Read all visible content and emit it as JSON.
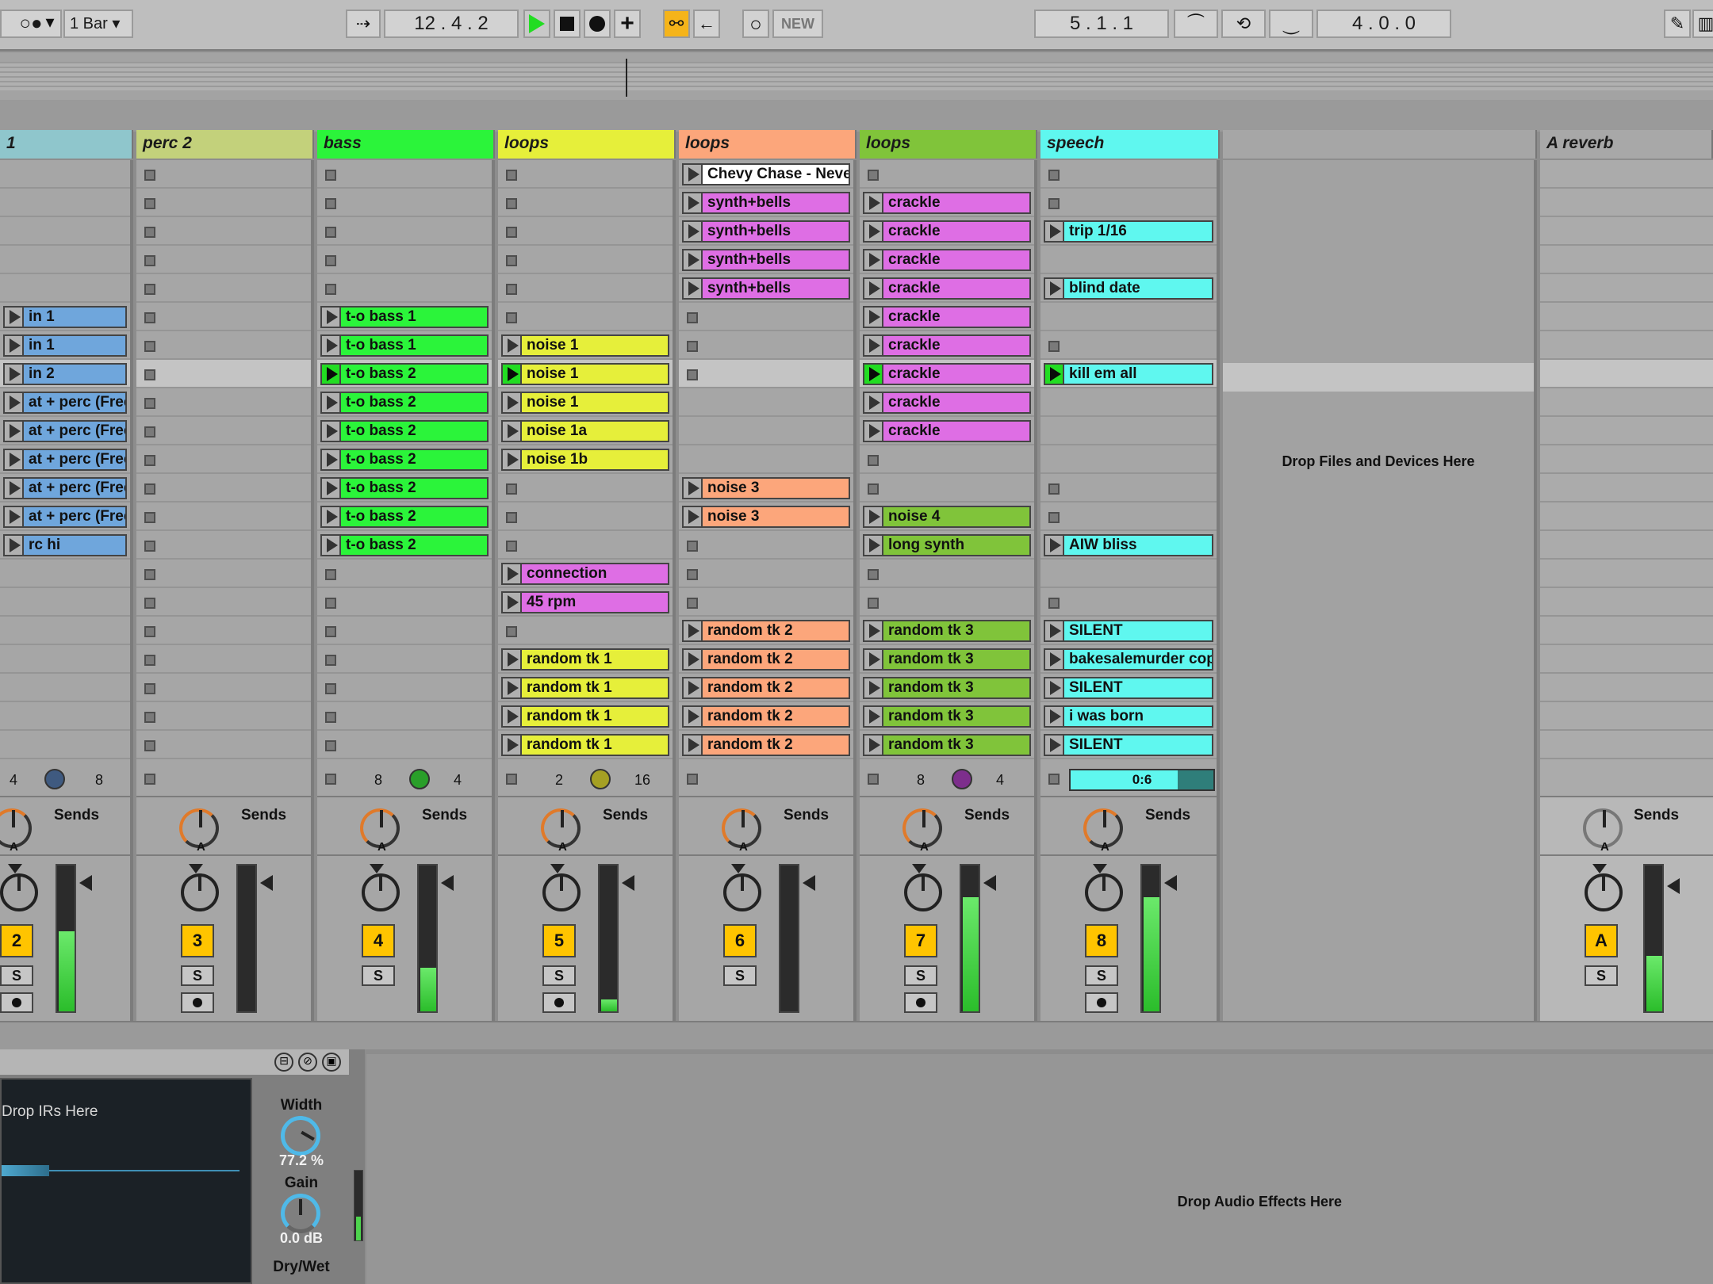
{
  "transport": {
    "quantize": "1 Bar",
    "arrangement_position": "12 .  4 .  2",
    "new_label": "NEW",
    "loop_start": "5 .  1 .  1",
    "loop_length": "4 .  0 .  0"
  },
  "tracks": [
    {
      "name": "1",
      "color": "#8fc6cc",
      "number": "2",
      "ctrl": [
        "4",
        "8"
      ],
      "knob_color": "#3f5a80",
      "meter": 0.55,
      "clips": [
        null,
        null,
        null,
        null,
        null,
        {
          "t": "in 1",
          "c": "#6fa6dc"
        },
        {
          "t": "in 1",
          "c": "#6fa6dc"
        },
        {
          "t": "in 2",
          "c": "#6fa6dc"
        },
        {
          "t": "at + perc (Freeze)",
          "c": "#6fa6dc"
        },
        {
          "t": "at + perc (Freeze)",
          "c": "#6fa6dc"
        },
        {
          "t": "at + perc (Freeze)",
          "c": "#6fa6dc"
        },
        {
          "t": "at + perc (Freeze)",
          "c": "#6fa6dc"
        },
        {
          "t": "at + perc (Freeze)",
          "c": "#6fa6dc"
        },
        {
          "t": "rc hi",
          "c": "#6fa6dc"
        },
        null,
        null,
        null,
        null,
        null,
        null,
        null
      ]
    },
    {
      "name": "perc 2",
      "color": "#c3d17b",
      "number": "3",
      "ctrl": null,
      "meter": 0.0,
      "clips": [
        "s",
        "s",
        "s",
        "s",
        "s",
        "s",
        "s",
        "s",
        "s",
        "s",
        "s",
        "s",
        "s",
        "s",
        "s",
        "s",
        "s",
        "s",
        "s",
        "s",
        "s"
      ]
    },
    {
      "name": "bass",
      "color": "#2bf43a",
      "number": "4",
      "ctrl": [
        "8",
        "4"
      ],
      "knob_color": "#2a9f2a",
      "meter": 0.3,
      "clips": [
        "s",
        "s",
        "s",
        "s",
        "s",
        {
          "t": "t-o bass 1",
          "c": "#2bf43a"
        },
        {
          "t": "t-o bass 1",
          "c": "#2bf43a"
        },
        {
          "t": "t-o bass 2",
          "c": "#2bf43a",
          "p": true
        },
        {
          "t": "t-o bass 2",
          "c": "#2bf43a"
        },
        {
          "t": "t-o bass 2",
          "c": "#2bf43a"
        },
        {
          "t": "t-o bass 2",
          "c": "#2bf43a"
        },
        {
          "t": "t-o bass 2",
          "c": "#2bf43a"
        },
        {
          "t": "t-o bass 2",
          "c": "#2bf43a"
        },
        {
          "t": "t-o bass 2",
          "c": "#2bf43a"
        },
        "s",
        "s",
        "s",
        "s",
        "s",
        "s",
        "s"
      ]
    },
    {
      "name": "loops",
      "color": "#e6ef3a",
      "number": "5",
      "ctrl": [
        "2",
        "16"
      ],
      "knob_color": "#a5a023",
      "meter": 0.08,
      "clips": [
        "s",
        "s",
        "s",
        "s",
        "s",
        "s",
        {
          "t": "noise 1",
          "c": "#e6ef3a"
        },
        {
          "t": "noise 1",
          "c": "#e6ef3a",
          "p": true
        },
        {
          "t": "noise 1",
          "c": "#e6ef3a"
        },
        {
          "t": "noise 1a",
          "c": "#e6ef3a"
        },
        {
          "t": "noise 1b",
          "c": "#e6ef3a"
        },
        "s",
        "s",
        "s",
        {
          "t": "connection",
          "c": "#de6ee4"
        },
        {
          "t": "45 rpm",
          "c": "#de6ee4"
        },
        "s",
        {
          "t": "random tk 1",
          "c": "#e6ef3a"
        },
        {
          "t": "random tk 1",
          "c": "#e6ef3a"
        },
        {
          "t": "random tk 1",
          "c": "#e6ef3a"
        },
        {
          "t": "random tk 1",
          "c": "#e6ef3a"
        }
      ]
    },
    {
      "name": "loops",
      "color": "#fca67b",
      "number": "6",
      "ctrl": null,
      "meter": 0.0,
      "clips": [
        {
          "t": "Chevy Chase - Neve",
          "c": "#ffffff"
        },
        {
          "t": "synth+bells",
          "c": "#de6ee4"
        },
        {
          "t": "synth+bells",
          "c": "#de6ee4"
        },
        {
          "t": "synth+bells",
          "c": "#de6ee4"
        },
        {
          "t": "synth+bells",
          "c": "#de6ee4"
        },
        "s",
        "s",
        "s",
        null,
        null,
        null,
        {
          "t": "noise 3",
          "c": "#fca67b"
        },
        {
          "t": "noise 3",
          "c": "#fca67b"
        },
        "s",
        "s",
        "s",
        {
          "t": "random tk 2",
          "c": "#fca67b"
        },
        {
          "t": "random tk 2",
          "c": "#fca67b"
        },
        {
          "t": "random tk 2",
          "c": "#fca67b"
        },
        {
          "t": "random tk 2",
          "c": "#fca67b"
        },
        {
          "t": "random tk 2",
          "c": "#fca67b"
        }
      ]
    },
    {
      "name": "loops",
      "color": "#80c43a",
      "number": "7",
      "ctrl": [
        "8",
        "4"
      ],
      "knob_color": "#7d2e8c",
      "meter": 0.78,
      "clips": [
        "s",
        {
          "t": "crackle",
          "c": "#de6ee4"
        },
        {
          "t": "crackle",
          "c": "#de6ee4"
        },
        {
          "t": "crackle",
          "c": "#de6ee4"
        },
        {
          "t": "crackle",
          "c": "#de6ee4"
        },
        {
          "t": "crackle",
          "c": "#de6ee4"
        },
        {
          "t": "crackle",
          "c": "#de6ee4"
        },
        {
          "t": "crackle",
          "c": "#de6ee4",
          "p": true
        },
        {
          "t": "crackle",
          "c": "#de6ee4"
        },
        {
          "t": "crackle",
          "c": "#de6ee4"
        },
        "s",
        "s",
        {
          "t": "noise 4",
          "c": "#80c43a"
        },
        {
          "t": "long synth",
          "c": "#80c43a"
        },
        "s",
        "s",
        {
          "t": "random tk 3",
          "c": "#80c43a"
        },
        {
          "t": "random tk 3",
          "c": "#80c43a"
        },
        {
          "t": "random tk 3",
          "c": "#80c43a"
        },
        {
          "t": "random tk 3",
          "c": "#80c43a"
        },
        {
          "t": "random tk 3",
          "c": "#80c43a"
        }
      ]
    },
    {
      "name": "speech",
      "color": "#5ff7ef",
      "number": "8",
      "ctrl": null,
      "counter": "0:6",
      "meter": 0.78,
      "clips": [
        "s",
        "s",
        {
          "t": "trip 1/16",
          "c": "#5ff7ef"
        },
        null,
        {
          "t": "blind date",
          "c": "#5ff7ef"
        },
        null,
        "s",
        {
          "t": "kill em all",
          "c": "#5ff7ef",
          "p": true
        },
        null,
        null,
        null,
        "s",
        "s",
        {
          "t": "AIW bliss",
          "c": "#5ff7ef"
        },
        null,
        "s",
        {
          "t": "SILENT",
          "c": "#5ff7ef"
        },
        {
          "t": "bakesalemurder cop",
          "c": "#5ff7ef"
        },
        {
          "t": "SILENT",
          "c": "#5ff7ef"
        },
        {
          "t": "i was born",
          "c": "#5ff7ef"
        },
        {
          "t": "SILENT",
          "c": "#5ff7ef"
        }
      ]
    }
  ],
  "drop_files": "Drop Files and Devices Here",
  "return_track": {
    "name": "A reverb",
    "number": "A"
  },
  "sends_label": "Sends",
  "send_key": "A",
  "solo_label": "S",
  "device": {
    "drop_irs": "Drop IRs Here",
    "width_label": "Width",
    "width_value": "77.2 %",
    "gain_label": "Gain",
    "gain_value": "0.0 dB",
    "drywet_label": "Dry/Wet"
  },
  "drop_effects": "Drop Audio Effects Here"
}
